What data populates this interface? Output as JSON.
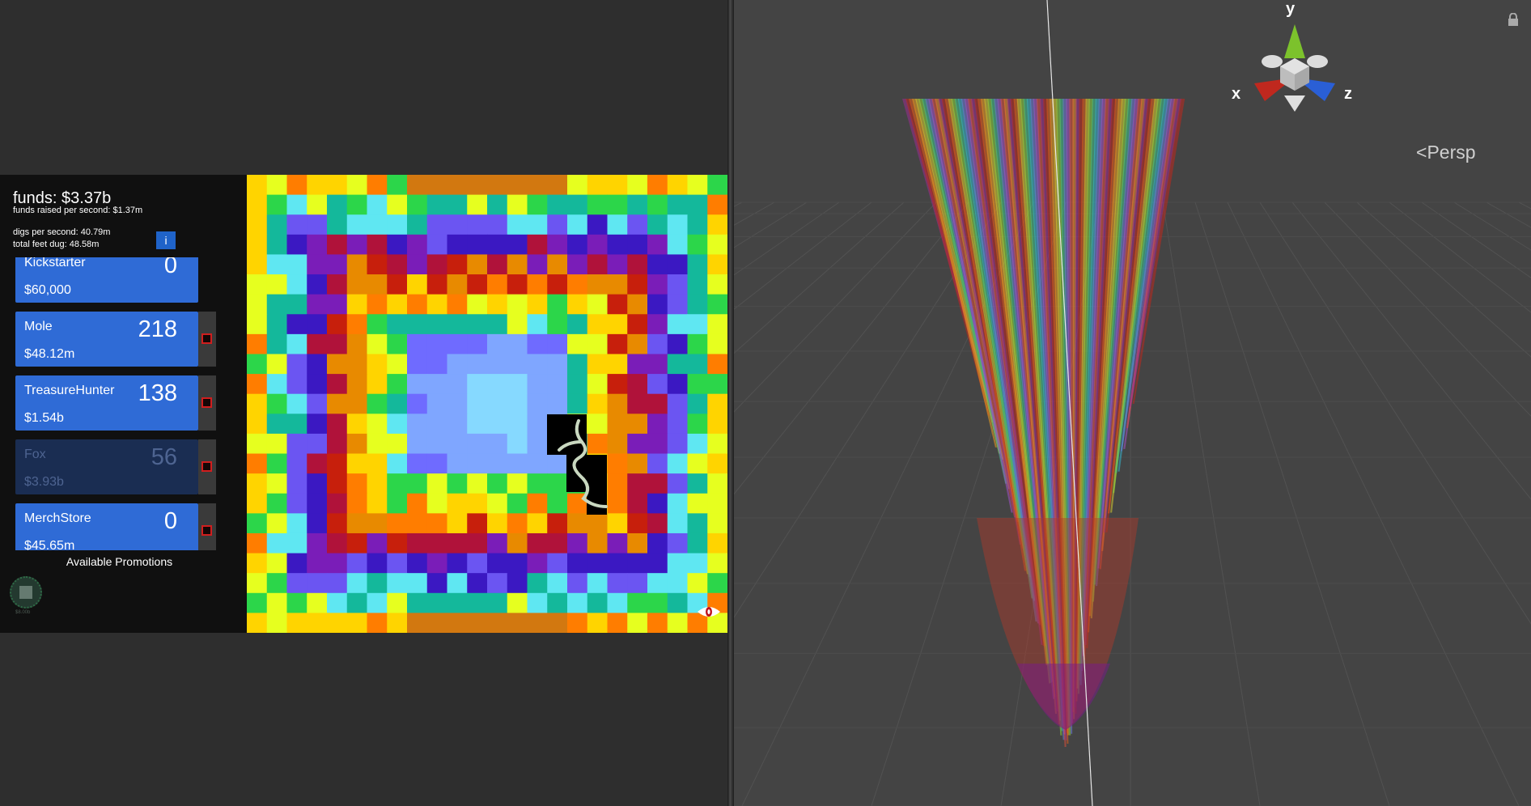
{
  "hud": {
    "funds": "funds: $3.37b",
    "funds_per_second": "funds raised per second: $1.37m",
    "digs_per_second": "digs per second: 40.79m",
    "total_feet": "total feet dug: 48.58m",
    "info_label": "i"
  },
  "upgrades": [
    {
      "name": "Kickstarter",
      "count": "0",
      "price": "$60,000",
      "enabled": true
    },
    {
      "name": "Mole",
      "count": "218",
      "price": "$48.12m",
      "enabled": true
    },
    {
      "name": "TreasureHunter",
      "count": "138",
      "price": "$1.54b",
      "enabled": true
    },
    {
      "name": "Fox",
      "count": "56",
      "price": "$3.93b",
      "enabled": false
    },
    {
      "name": "MerchStore",
      "count": "0",
      "price": "$45.65m",
      "enabled": true
    }
  ],
  "promotions": {
    "title": "Available Promotions",
    "item_label": "$8.00b"
  },
  "scene": {
    "gizmo_axes": [
      "y",
      "x",
      "z"
    ],
    "projection": "Persp",
    "colors": {
      "x_axis": "#c0281e",
      "y_axis": "#7cc22c",
      "z_axis": "#2a5fd6",
      "background": "#444444"
    }
  },
  "board": {
    "ring_palette": [
      "#ff7d00",
      "#ffd400",
      "#e6ff1f",
      "#2cd64a",
      "#14b89b",
      "#5fe7f2",
      "#6b55f2",
      "#3b18c2",
      "#7a1db8",
      "#b0123a",
      "#c71f0c",
      "#e88a00"
    ],
    "top_band_color": "#d27810",
    "interior": [
      "#4a2aa0",
      "#5b3de6",
      "#6f6bff",
      "#7fa6ff",
      "#86d9ff"
    ]
  }
}
